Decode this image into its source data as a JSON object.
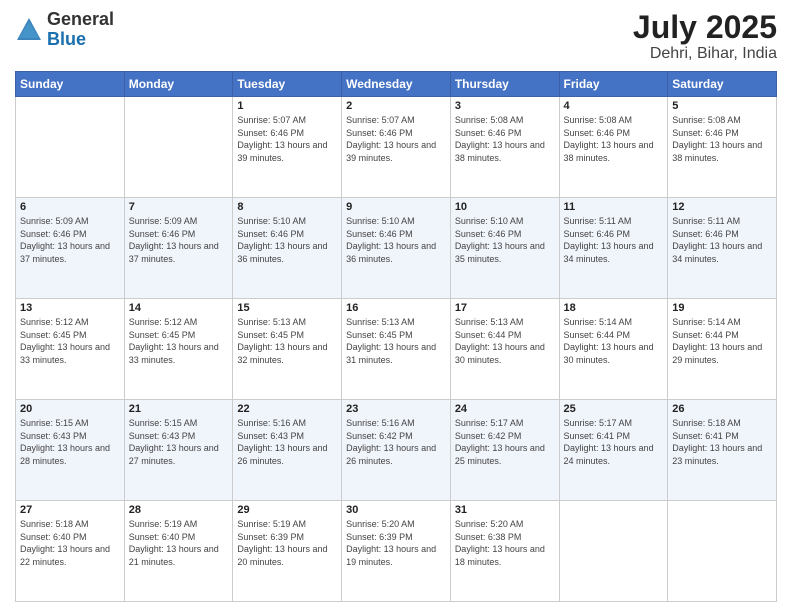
{
  "header": {
    "logo_general": "General",
    "logo_blue": "Blue",
    "main_title": "July 2025",
    "subtitle": "Dehri, Bihar, India"
  },
  "days_of_week": [
    "Sunday",
    "Monday",
    "Tuesday",
    "Wednesday",
    "Thursday",
    "Friday",
    "Saturday"
  ],
  "weeks": [
    [
      {
        "day": "",
        "info": ""
      },
      {
        "day": "",
        "info": ""
      },
      {
        "day": "1",
        "info": "Sunrise: 5:07 AM\nSunset: 6:46 PM\nDaylight: 13 hours and 39 minutes."
      },
      {
        "day": "2",
        "info": "Sunrise: 5:07 AM\nSunset: 6:46 PM\nDaylight: 13 hours and 39 minutes."
      },
      {
        "day": "3",
        "info": "Sunrise: 5:08 AM\nSunset: 6:46 PM\nDaylight: 13 hours and 38 minutes."
      },
      {
        "day": "4",
        "info": "Sunrise: 5:08 AM\nSunset: 6:46 PM\nDaylight: 13 hours and 38 minutes."
      },
      {
        "day": "5",
        "info": "Sunrise: 5:08 AM\nSunset: 6:46 PM\nDaylight: 13 hours and 38 minutes."
      }
    ],
    [
      {
        "day": "6",
        "info": "Sunrise: 5:09 AM\nSunset: 6:46 PM\nDaylight: 13 hours and 37 minutes."
      },
      {
        "day": "7",
        "info": "Sunrise: 5:09 AM\nSunset: 6:46 PM\nDaylight: 13 hours and 37 minutes."
      },
      {
        "day": "8",
        "info": "Sunrise: 5:10 AM\nSunset: 6:46 PM\nDaylight: 13 hours and 36 minutes."
      },
      {
        "day": "9",
        "info": "Sunrise: 5:10 AM\nSunset: 6:46 PM\nDaylight: 13 hours and 36 minutes."
      },
      {
        "day": "10",
        "info": "Sunrise: 5:10 AM\nSunset: 6:46 PM\nDaylight: 13 hours and 35 minutes."
      },
      {
        "day": "11",
        "info": "Sunrise: 5:11 AM\nSunset: 6:46 PM\nDaylight: 13 hours and 34 minutes."
      },
      {
        "day": "12",
        "info": "Sunrise: 5:11 AM\nSunset: 6:46 PM\nDaylight: 13 hours and 34 minutes."
      }
    ],
    [
      {
        "day": "13",
        "info": "Sunrise: 5:12 AM\nSunset: 6:45 PM\nDaylight: 13 hours and 33 minutes."
      },
      {
        "day": "14",
        "info": "Sunrise: 5:12 AM\nSunset: 6:45 PM\nDaylight: 13 hours and 33 minutes."
      },
      {
        "day": "15",
        "info": "Sunrise: 5:13 AM\nSunset: 6:45 PM\nDaylight: 13 hours and 32 minutes."
      },
      {
        "day": "16",
        "info": "Sunrise: 5:13 AM\nSunset: 6:45 PM\nDaylight: 13 hours and 31 minutes."
      },
      {
        "day": "17",
        "info": "Sunrise: 5:13 AM\nSunset: 6:44 PM\nDaylight: 13 hours and 30 minutes."
      },
      {
        "day": "18",
        "info": "Sunrise: 5:14 AM\nSunset: 6:44 PM\nDaylight: 13 hours and 30 minutes."
      },
      {
        "day": "19",
        "info": "Sunrise: 5:14 AM\nSunset: 6:44 PM\nDaylight: 13 hours and 29 minutes."
      }
    ],
    [
      {
        "day": "20",
        "info": "Sunrise: 5:15 AM\nSunset: 6:43 PM\nDaylight: 13 hours and 28 minutes."
      },
      {
        "day": "21",
        "info": "Sunrise: 5:15 AM\nSunset: 6:43 PM\nDaylight: 13 hours and 27 minutes."
      },
      {
        "day": "22",
        "info": "Sunrise: 5:16 AM\nSunset: 6:43 PM\nDaylight: 13 hours and 26 minutes."
      },
      {
        "day": "23",
        "info": "Sunrise: 5:16 AM\nSunset: 6:42 PM\nDaylight: 13 hours and 26 minutes."
      },
      {
        "day": "24",
        "info": "Sunrise: 5:17 AM\nSunset: 6:42 PM\nDaylight: 13 hours and 25 minutes."
      },
      {
        "day": "25",
        "info": "Sunrise: 5:17 AM\nSunset: 6:41 PM\nDaylight: 13 hours and 24 minutes."
      },
      {
        "day": "26",
        "info": "Sunrise: 5:18 AM\nSunset: 6:41 PM\nDaylight: 13 hours and 23 minutes."
      }
    ],
    [
      {
        "day": "27",
        "info": "Sunrise: 5:18 AM\nSunset: 6:40 PM\nDaylight: 13 hours and 22 minutes."
      },
      {
        "day": "28",
        "info": "Sunrise: 5:19 AM\nSunset: 6:40 PM\nDaylight: 13 hours and 21 minutes."
      },
      {
        "day": "29",
        "info": "Sunrise: 5:19 AM\nSunset: 6:39 PM\nDaylight: 13 hours and 20 minutes."
      },
      {
        "day": "30",
        "info": "Sunrise: 5:20 AM\nSunset: 6:39 PM\nDaylight: 13 hours and 19 minutes."
      },
      {
        "day": "31",
        "info": "Sunrise: 5:20 AM\nSunset: 6:38 PM\nDaylight: 13 hours and 18 minutes."
      },
      {
        "day": "",
        "info": ""
      },
      {
        "day": "",
        "info": ""
      }
    ]
  ]
}
